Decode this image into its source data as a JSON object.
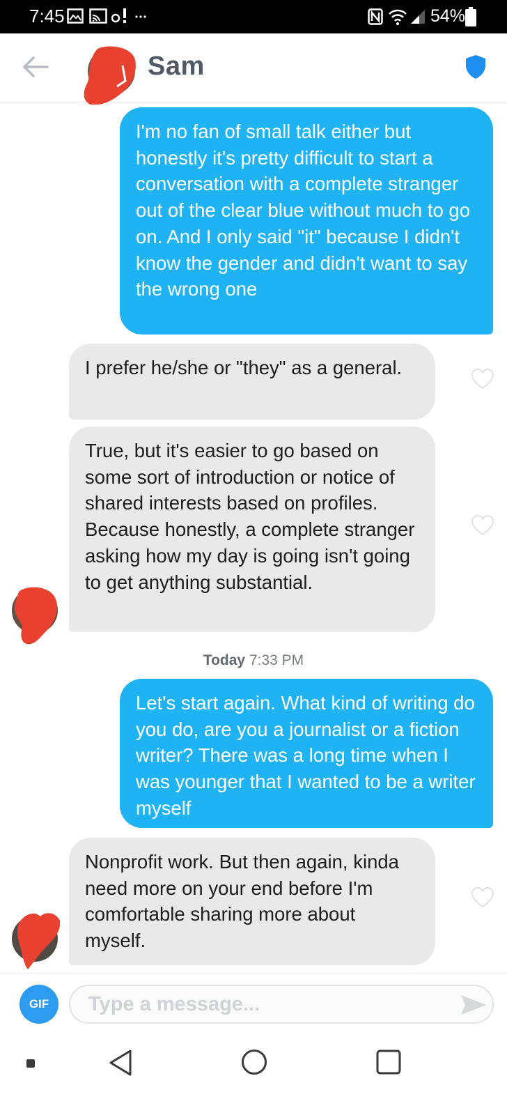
{
  "status_bar": {
    "time": "7:45",
    "battery": "54%",
    "icons": [
      "gallery-icon",
      "cast-icon",
      "alert-icon",
      "more-dots-icon",
      "nfc-icon",
      "wifi-icon",
      "signal-icon",
      "battery-icon"
    ]
  },
  "header": {
    "contact_name": "Sam",
    "back_icon": "arrow-left-icon",
    "safety_icon": "shield-icon"
  },
  "messages": [
    {
      "sender": "me",
      "text": "I'm no fan of small talk either but honestly it's pretty difficult to start a conversation with a complete stranger out of the clear blue without much to go on. And I only said \"it\" because I didn't know the gender and didn't want to say the wrong one"
    },
    {
      "sender": "them",
      "text": "I prefer he/she or \"they\" as a general."
    },
    {
      "sender": "them",
      "text": "True, but it's easier to go based on some sort of introduction or notice of shared interests based on profiles. Because honestly, a complete stranger asking how my day is going isn't going to get anything substantial."
    },
    {
      "sender": "me",
      "text": "Let's start again. What kind of writing do you do, are you a journalist or a fiction writer? There was a long time when I was younger that I wanted to be a writer myself"
    },
    {
      "sender": "them",
      "text": "Nonprofit work. But then again, kinda need more on your end before I'm comfortable sharing more about myself."
    }
  ],
  "timestamp": {
    "day": "Today",
    "time": "7:33 PM"
  },
  "composer": {
    "gif_label": "GIF",
    "placeholder": "Type a message...",
    "value": "",
    "send_icon": "send-icon"
  },
  "colors": {
    "sent_bubble": "#1fb3f4",
    "received_bubble": "#e9e9e9",
    "shield": "#1f8ef1",
    "gif_button": "#2d9bf0",
    "redaction": "#e8412f"
  }
}
